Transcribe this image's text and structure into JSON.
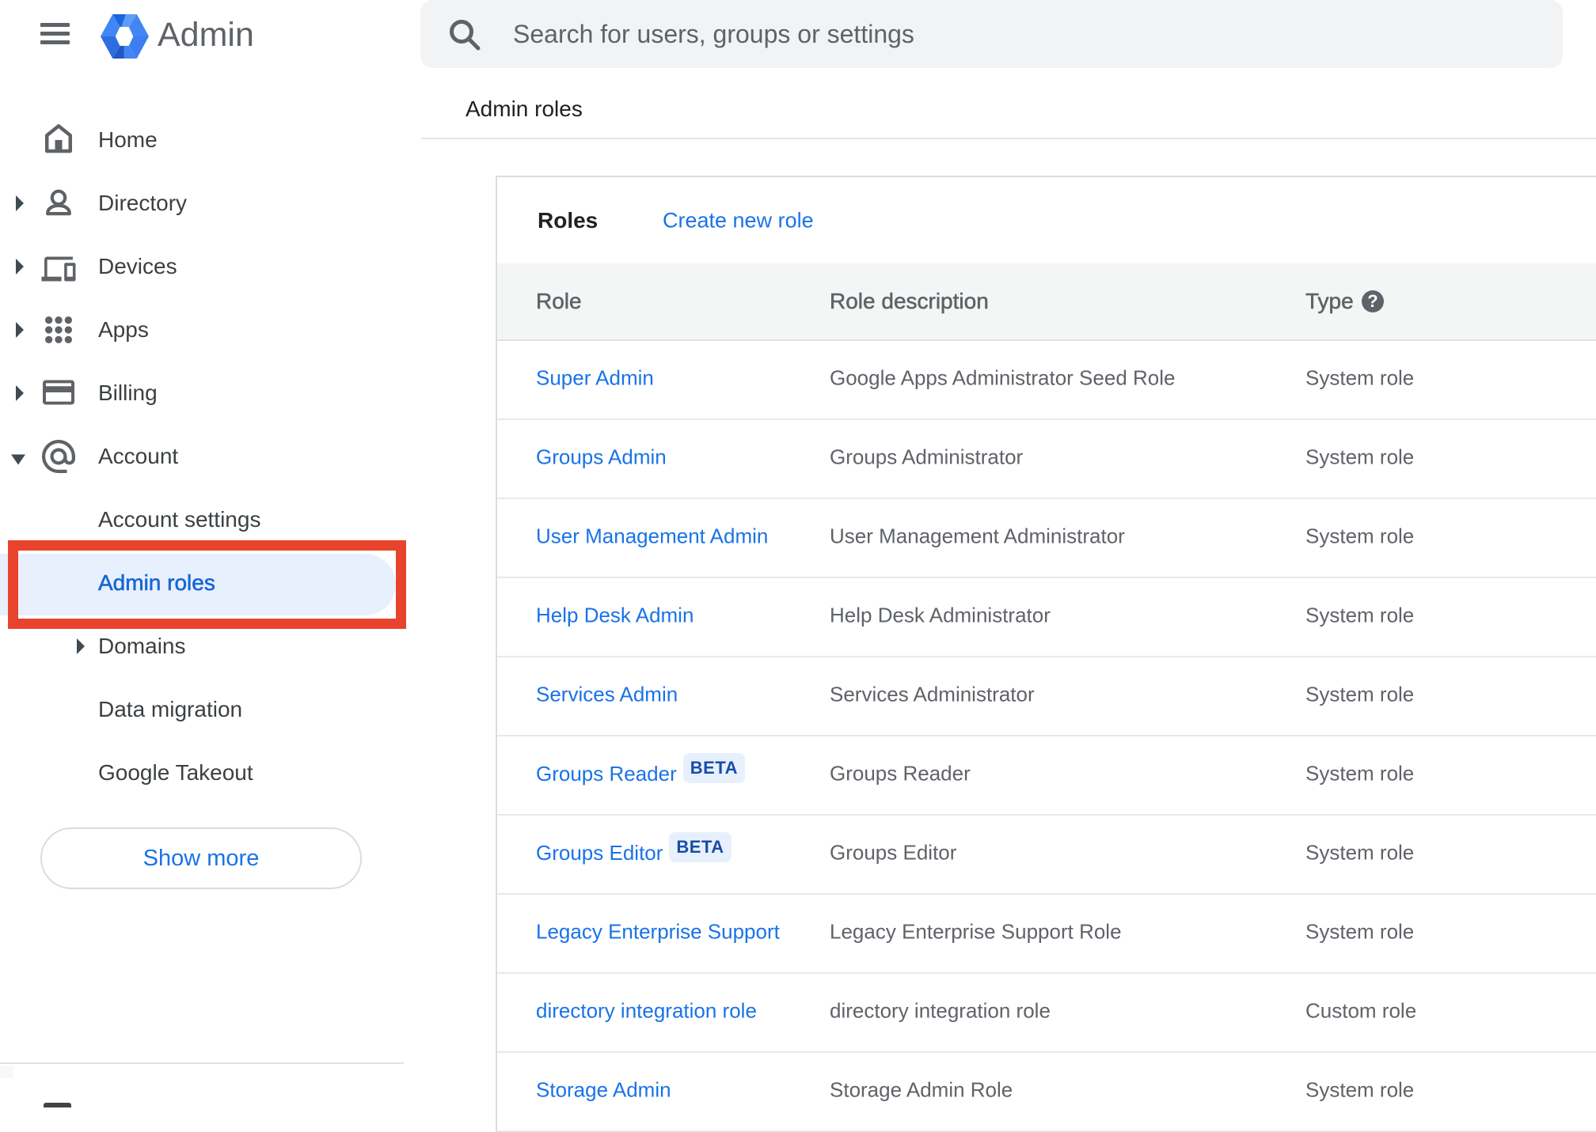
{
  "header": {
    "app_title": "Admin",
    "search": {
      "placeholder": "Search for users, groups or settings"
    }
  },
  "page": {
    "title": "Admin roles"
  },
  "sidebar": {
    "items": [
      {
        "id": "home",
        "label": "Home",
        "icon": "home",
        "expander": "none",
        "level": 0,
        "selected": false
      },
      {
        "id": "directory",
        "label": "Directory",
        "icon": "person",
        "expander": "right",
        "level": 0,
        "selected": false
      },
      {
        "id": "devices",
        "label": "Devices",
        "icon": "devices",
        "expander": "right",
        "level": 0,
        "selected": false
      },
      {
        "id": "apps",
        "label": "Apps",
        "icon": "apps",
        "expander": "right",
        "level": 0,
        "selected": false
      },
      {
        "id": "billing",
        "label": "Billing",
        "icon": "billing",
        "expander": "right",
        "level": 0,
        "selected": false
      },
      {
        "id": "account",
        "label": "Account",
        "icon": "at",
        "expander": "down",
        "level": 0,
        "selected": false
      },
      {
        "id": "account-settings",
        "label": "Account settings",
        "icon": null,
        "expander": "none",
        "level": 1,
        "selected": false
      },
      {
        "id": "admin-roles",
        "label": "Admin roles",
        "icon": null,
        "expander": "none",
        "level": 1,
        "selected": true
      },
      {
        "id": "domains",
        "label": "Domains",
        "icon": null,
        "expander": "right",
        "level": 1,
        "selected": false
      },
      {
        "id": "data-migration",
        "label": "Data migration",
        "icon": null,
        "expander": "none",
        "level": 1,
        "selected": false
      },
      {
        "id": "google-takeout",
        "label": "Google Takeout",
        "icon": null,
        "expander": "none",
        "level": 1,
        "selected": false
      }
    ],
    "show_more_label": "Show more"
  },
  "roles_card": {
    "title": "Roles",
    "create_link": "Create new role",
    "columns": {
      "role": "Role",
      "description": "Role description",
      "type": "Type"
    },
    "help_glyph": "?",
    "rows": [
      {
        "role": "Super Admin",
        "badge": null,
        "description": "Google Apps Administrator Seed Role",
        "type": "System role"
      },
      {
        "role": "Groups Admin",
        "badge": null,
        "description": "Groups Administrator",
        "type": "System role"
      },
      {
        "role": "User Management Admin",
        "badge": null,
        "description": "User Management Administrator",
        "type": "System role"
      },
      {
        "role": "Help Desk Admin",
        "badge": null,
        "description": "Help Desk Administrator",
        "type": "System role"
      },
      {
        "role": "Services Admin",
        "badge": null,
        "description": "Services Administrator",
        "type": "System role"
      },
      {
        "role": "Groups Reader",
        "badge": "BETA",
        "description": "Groups Reader",
        "type": "System role"
      },
      {
        "role": "Groups Editor",
        "badge": "BETA",
        "description": "Groups Editor",
        "type": "System role"
      },
      {
        "role": "Legacy Enterprise Support",
        "badge": null,
        "description": "Legacy Enterprise Support Role",
        "type": "System role"
      },
      {
        "role": "directory integration role",
        "badge": null,
        "description": "directory integration role",
        "type": "Custom role"
      },
      {
        "role": "Storage Admin",
        "badge": null,
        "description": "Storage Admin Role",
        "type": "System role"
      }
    ]
  },
  "annotation": {
    "color": "#e8432c"
  }
}
